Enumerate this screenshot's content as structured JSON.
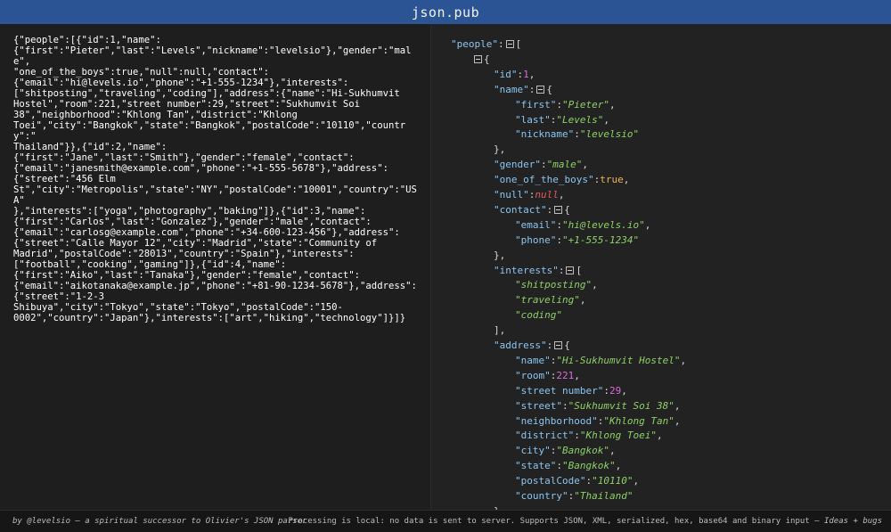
{
  "header": {
    "title": "json.pub"
  },
  "raw_input": "{\"people\":[{\"id\":1,\"name\":\n{\"first\":\"Pieter\",\"last\":\"Levels\",\"nickname\":\"levelsio\"},\"gender\":\"male\",\n\"one_of_the_boys\":true,\"null\":null,\"contact\":\n{\"email\":\"hi@levels.io\",\"phone\":\"+1-555-1234\"},\"interests\":\n[\"shitposting\",\"traveling\",\"coding\"],\"address\":{\"name\":\"Hi-Sukhumvit\nHostel\",\"room\":221,\"street number\":29,\"street\":\"Sukhumvit Soi\n38\",\"neighborhood\":\"Khlong Tan\",\"district\":\"Khlong\nToei\",\"city\":\"Bangkok\",\"state\":\"Bangkok\",\"postalCode\":\"10110\",\"country\":\"\nThailand\"}},{\"id\":2,\"name\":\n{\"first\":\"Jane\",\"last\":\"Smith\"},\"gender\":\"female\",\"contact\":\n{\"email\":\"janesmith@example.com\",\"phone\":\"+1-555-5678\"},\"address\":\n{\"street\":\"456 Elm\nSt\",\"city\":\"Metropolis\",\"state\":\"NY\",\"postalCode\":\"10001\",\"country\":\"USA\"\n},\"interests\":[\"yoga\",\"photography\",\"baking\"]},{\"id\":3,\"name\":\n{\"first\":\"Carlos\",\"last\":\"Gonzalez\"},\"gender\":\"male\",\"contact\":\n{\"email\":\"carlosg@example.com\",\"phone\":\"+34-600-123-456\"},\"address\":\n{\"street\":\"Calle Mayor 12\",\"city\":\"Madrid\",\"state\":\"Community of\nMadrid\",\"postalCode\":\"28013\",\"country\":\"Spain\"},\"interests\":\n[\"football\",\"cooking\",\"gaming\"]},{\"id\":4,\"name\":\n{\"first\":\"Aiko\",\"last\":\"Tanaka\"},\"gender\":\"female\",\"contact\":\n{\"email\":\"aikotanaka@example.jp\",\"phone\":\"+81-90-1234-5678\"},\"address\":\n{\"street\":\"1-2-3\nShibuya\",\"city\":\"Tokyo\",\"state\":\"Tokyo\",\"postalCode\":\"150-\n0002\",\"country\":\"Japan\"},\"interests\":[\"art\",\"hiking\",\"technology\"]}]}",
  "tree_rows": [
    {
      "indent": 0,
      "parts": [
        {
          "t": "\"people\"",
          "c": "k"
        },
        {
          "t": ":",
          "c": "p"
        },
        {
          "tog": true
        },
        {
          "t": "[",
          "c": "p"
        }
      ]
    },
    {
      "indent": 1,
      "parts": [
        {
          "tog": true
        },
        {
          "t": "{",
          "c": "p"
        }
      ]
    },
    {
      "indent": 2,
      "parts": [
        {
          "t": "\"id\"",
          "c": "k"
        },
        {
          "t": ":",
          "c": "p"
        },
        {
          "t": "1",
          "c": "n"
        },
        {
          "t": ",",
          "c": "p"
        }
      ]
    },
    {
      "indent": 2,
      "parts": [
        {
          "t": "\"name\"",
          "c": "k"
        },
        {
          "t": ":",
          "c": "p"
        },
        {
          "tog": true
        },
        {
          "t": "{",
          "c": "p"
        }
      ]
    },
    {
      "indent": 3,
      "parts": [
        {
          "t": "\"first\"",
          "c": "k"
        },
        {
          "t": ":",
          "c": "p"
        },
        {
          "t": "\"Pieter\"",
          "c": "s"
        },
        {
          "t": ",",
          "c": "p"
        }
      ]
    },
    {
      "indent": 3,
      "parts": [
        {
          "t": "\"last\"",
          "c": "k"
        },
        {
          "t": ":",
          "c": "p"
        },
        {
          "t": "\"Levels\"",
          "c": "s"
        },
        {
          "t": ",",
          "c": "p"
        }
      ]
    },
    {
      "indent": 3,
      "parts": [
        {
          "t": "\"nickname\"",
          "c": "k"
        },
        {
          "t": ":",
          "c": "p"
        },
        {
          "t": "\"levelsio\"",
          "c": "s"
        }
      ]
    },
    {
      "indent": 2,
      "parts": [
        {
          "t": "},",
          "c": "p"
        }
      ]
    },
    {
      "indent": 2,
      "parts": [
        {
          "t": "\"gender\"",
          "c": "k"
        },
        {
          "t": ":",
          "c": "p"
        },
        {
          "t": "\"male\"",
          "c": "s"
        },
        {
          "t": ",",
          "c": "p"
        }
      ]
    },
    {
      "indent": 2,
      "parts": [
        {
          "t": "\"one_of_the_boys\"",
          "c": "k"
        },
        {
          "t": ":",
          "c": "p"
        },
        {
          "t": "true",
          "c": "b"
        },
        {
          "t": ",",
          "c": "p"
        }
      ]
    },
    {
      "indent": 2,
      "parts": [
        {
          "t": "\"null\"",
          "c": "k"
        },
        {
          "t": ":",
          "c": "p"
        },
        {
          "t": "null",
          "c": "nul"
        },
        {
          "t": ",",
          "c": "p"
        }
      ]
    },
    {
      "indent": 2,
      "parts": [
        {
          "t": "\"contact\"",
          "c": "k"
        },
        {
          "t": ":",
          "c": "p"
        },
        {
          "tog": true
        },
        {
          "t": "{",
          "c": "p"
        }
      ]
    },
    {
      "indent": 3,
      "parts": [
        {
          "t": "\"email\"",
          "c": "k"
        },
        {
          "t": ":",
          "c": "p"
        },
        {
          "t": "\"hi@levels.io\"",
          "c": "s"
        },
        {
          "t": ",",
          "c": "p"
        }
      ]
    },
    {
      "indent": 3,
      "parts": [
        {
          "t": "\"phone\"",
          "c": "k"
        },
        {
          "t": ":",
          "c": "p"
        },
        {
          "t": "\"+1-555-1234\"",
          "c": "s"
        }
      ]
    },
    {
      "indent": 2,
      "parts": [
        {
          "t": "},",
          "c": "p"
        }
      ]
    },
    {
      "indent": 2,
      "parts": [
        {
          "t": "\"interests\"",
          "c": "k"
        },
        {
          "t": ":",
          "c": "p"
        },
        {
          "tog": true
        },
        {
          "t": "[",
          "c": "p"
        }
      ]
    },
    {
      "indent": 3,
      "parts": [
        {
          "t": "\"shitposting\"",
          "c": "s"
        },
        {
          "t": ",",
          "c": "p"
        }
      ]
    },
    {
      "indent": 3,
      "parts": [
        {
          "t": "\"traveling\"",
          "c": "s"
        },
        {
          "t": ",",
          "c": "p"
        }
      ]
    },
    {
      "indent": 3,
      "parts": [
        {
          "t": "\"coding\"",
          "c": "s"
        }
      ]
    },
    {
      "indent": 2,
      "parts": [
        {
          "t": "],",
          "c": "p"
        }
      ]
    },
    {
      "indent": 2,
      "parts": [
        {
          "t": "\"address\"",
          "c": "k"
        },
        {
          "t": ":",
          "c": "p"
        },
        {
          "tog": true
        },
        {
          "t": "{",
          "c": "p"
        }
      ]
    },
    {
      "indent": 3,
      "parts": [
        {
          "t": "\"name\"",
          "c": "k"
        },
        {
          "t": ":",
          "c": "p"
        },
        {
          "t": "\"Hi-Sukhumvit Hostel\"",
          "c": "s"
        },
        {
          "t": ",",
          "c": "p"
        }
      ]
    },
    {
      "indent": 3,
      "parts": [
        {
          "t": "\"room\"",
          "c": "k"
        },
        {
          "t": ":",
          "c": "p"
        },
        {
          "t": "221",
          "c": "n"
        },
        {
          "t": ",",
          "c": "p"
        }
      ]
    },
    {
      "indent": 3,
      "parts": [
        {
          "t": "\"street number\"",
          "c": "k"
        },
        {
          "t": ":",
          "c": "p"
        },
        {
          "t": "29",
          "c": "n"
        },
        {
          "t": ",",
          "c": "p"
        }
      ]
    },
    {
      "indent": 3,
      "parts": [
        {
          "t": "\"street\"",
          "c": "k"
        },
        {
          "t": ":",
          "c": "p"
        },
        {
          "t": "\"Sukhumvit Soi 38\"",
          "c": "s"
        },
        {
          "t": ",",
          "c": "p"
        }
      ]
    },
    {
      "indent": 3,
      "parts": [
        {
          "t": "\"neighborhood\"",
          "c": "k"
        },
        {
          "t": ":",
          "c": "p"
        },
        {
          "t": "\"Khlong Tan\"",
          "c": "s"
        },
        {
          "t": ",",
          "c": "p"
        }
      ]
    },
    {
      "indent": 3,
      "parts": [
        {
          "t": "\"district\"",
          "c": "k"
        },
        {
          "t": ":",
          "c": "p"
        },
        {
          "t": "\"Khlong Toei\"",
          "c": "s"
        },
        {
          "t": ",",
          "c": "p"
        }
      ]
    },
    {
      "indent": 3,
      "parts": [
        {
          "t": "\"city\"",
          "c": "k"
        },
        {
          "t": ":",
          "c": "p"
        },
        {
          "t": "\"Bangkok\"",
          "c": "s"
        },
        {
          "t": ",",
          "c": "p"
        }
      ]
    },
    {
      "indent": 3,
      "parts": [
        {
          "t": "\"state\"",
          "c": "k"
        },
        {
          "t": ":",
          "c": "p"
        },
        {
          "t": "\"Bangkok\"",
          "c": "s"
        },
        {
          "t": ",",
          "c": "p"
        }
      ]
    },
    {
      "indent": 3,
      "parts": [
        {
          "t": "\"postalCode\"",
          "c": "k"
        },
        {
          "t": ":",
          "c": "p"
        },
        {
          "t": "\"10110\"",
          "c": "s"
        },
        {
          "t": ",",
          "c": "p"
        }
      ]
    },
    {
      "indent": 3,
      "parts": [
        {
          "t": "\"country\"",
          "c": "k"
        },
        {
          "t": ":",
          "c": "p"
        },
        {
          "t": "\"Thailand\"",
          "c": "s"
        }
      ]
    },
    {
      "indent": 2,
      "parts": [
        {
          "t": "}",
          "c": "p"
        }
      ]
    }
  ],
  "footer": {
    "left": "by @levelsio — a spiritual successor to Olivier's JSON parser",
    "right": "Processing is local: no data is sent to server. Supports JSON, XML, serialized, hex, base64 and binary input — ",
    "right_link": "Ideas + bugs"
  },
  "colors": {
    "header_bg": "#2a5494",
    "key": "#8cc5f0",
    "string": "#8fd06a",
    "number": "#d76bd8",
    "null": "#e05c5c",
    "boolean": "#f0b35a"
  }
}
